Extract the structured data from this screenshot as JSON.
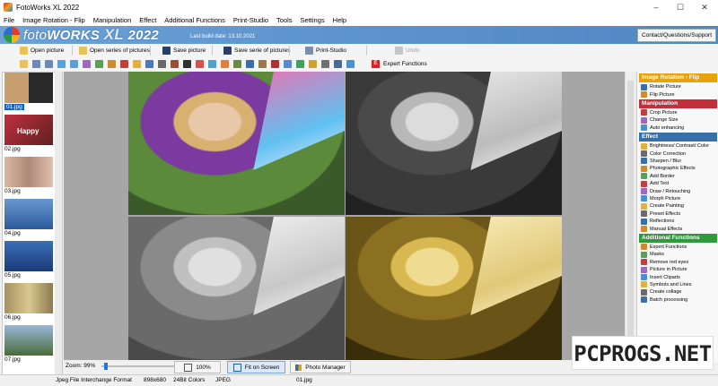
{
  "window": {
    "title": "FotoWorks XL 2022",
    "controls": [
      "–",
      "☐",
      "✕"
    ]
  },
  "menu": [
    "File",
    "Image Rotation - Flip",
    "Manipulation",
    "Effect",
    "Additional Functions",
    "Print-Studio",
    "Tools",
    "Settings",
    "Help"
  ],
  "banner": {
    "brand_foto": "foto",
    "brand_works": "WORKS",
    "brand_xl": "XL",
    "brand_year": "2022",
    "build": "Last build date: 13.10.2021",
    "contact": "Contact/Questions/Support"
  },
  "toolbar": {
    "open_picture": "Open picture",
    "open_series": "Open series of pictures",
    "save_picture": "Save picture",
    "save_series": "Save serie of pictures",
    "print_studio": "Print-Studio",
    "undo": "Undo",
    "expert_functions": "Expert Functions",
    "expert_glyph": "E"
  },
  "thumbnails": [
    {
      "file": "01.jpg",
      "selected": true
    },
    {
      "file": "02.jpg",
      "selected": false,
      "overlay": "Happy"
    },
    {
      "file": "03.jpg",
      "selected": false
    },
    {
      "file": "04.jpg",
      "selected": false
    },
    {
      "file": "05.jpg",
      "selected": false
    },
    {
      "file": "06.jpg",
      "selected": false
    },
    {
      "file": "07.jpg",
      "selected": false
    }
  ],
  "side_panel": {
    "sections": [
      {
        "title": "Image Rotation - Flip",
        "color": "#e8a20c",
        "items": [
          "Rotate Picture",
          "Flip Picture"
        ]
      },
      {
        "title": "Manipulation",
        "color": "#c0303a",
        "items": [
          "Crop Picture",
          "Change Size",
          "Auto enhancing"
        ]
      },
      {
        "title": "Effect",
        "color": "#3a6ea6",
        "items": [
          "Brightness/ Contrast/ Color",
          "Color Correction",
          "Sharpen / Blur",
          "Photographic Effects",
          "Add Border",
          "Add Text",
          "Draw / Retouching",
          "Morph Picture",
          "Create Painting",
          "Preset Effects",
          "Reflections",
          "Manual Effects"
        ]
      },
      {
        "title": "Additional Functions",
        "color": "#2f9a3c",
        "items": [
          "Expert Functions",
          "Masks",
          "Remove red eyes",
          "Picture in Picture",
          "Insert Cliparts",
          "Symbols and Lines",
          "Create collage",
          "Batch processing"
        ]
      }
    ]
  },
  "zoom": {
    "label": "Zoom:",
    "value": "99%",
    "level": 0.04,
    "btn_100": "100%",
    "btn_fit": "Fit on Screen",
    "btn_manager": "Photo Manager"
  },
  "status": {
    "format": "Jpeg File Interchange Format",
    "dims": "898x680",
    "colors": "24Bit Colors",
    "type": "JPEG",
    "file": "01.jpg"
  },
  "watermark": "PCPROGS.NET"
}
